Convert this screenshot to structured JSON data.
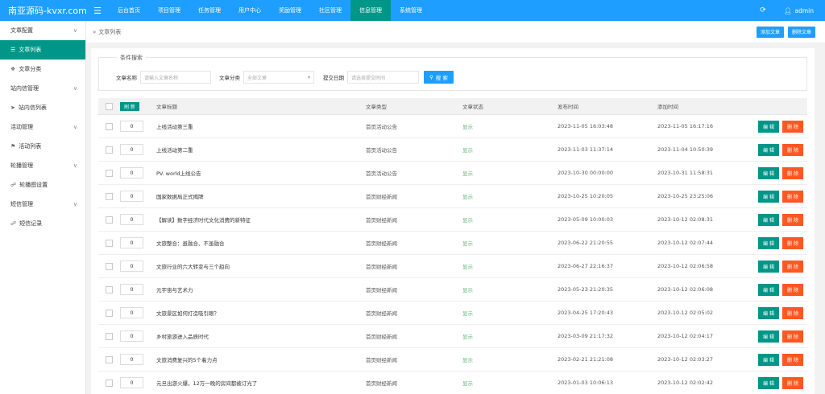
{
  "header": {
    "logo": "南亚源码-kvxr.com",
    "menu_icon": "hamburger-icon",
    "nav": [
      {
        "label": "后台首页",
        "active": false
      },
      {
        "label": "项目管理",
        "active": false
      },
      {
        "label": "任务管理",
        "active": false
      },
      {
        "label": "用户中心",
        "active": false
      },
      {
        "label": "奖励管理",
        "active": false
      },
      {
        "label": "社区管理",
        "active": false
      },
      {
        "label": "信息管理",
        "active": true
      },
      {
        "label": "系统管理",
        "active": false
      }
    ],
    "refresh_icon": "refresh-icon",
    "user_name": "admin"
  },
  "sidebar": {
    "items": [
      {
        "type": "group",
        "label": "文章配置"
      },
      {
        "type": "item",
        "label": "文章列表",
        "active": true
      },
      {
        "type": "item",
        "label": "文章分类",
        "active": false
      },
      {
        "type": "group",
        "label": "站内信管理"
      },
      {
        "type": "item",
        "label": "站内信列表",
        "active": false
      },
      {
        "type": "group",
        "label": "活动管理"
      },
      {
        "type": "item",
        "label": "活动列表",
        "active": false
      },
      {
        "type": "group",
        "label": "轮播管理"
      },
      {
        "type": "item",
        "label": "轮播图设置",
        "active": false
      },
      {
        "type": "group",
        "label": "短信管理"
      },
      {
        "type": "item",
        "label": "短信记录",
        "active": false
      }
    ]
  },
  "breadcrumb": {
    "label": "文章列表"
  },
  "actions": {
    "add": "添加文章",
    "delete": "删除文章"
  },
  "search": {
    "legend": "条件搜索",
    "name_label": "文章名称",
    "name_placeholder": "请输入文章名称",
    "category_label": "文章分类",
    "category_value": "全部文章",
    "date_label": "提交日期",
    "date_placeholder": "请选择提交时间",
    "button": "搜 索"
  },
  "table": {
    "refresh_button": "刷 新",
    "columns": [
      "文章标题",
      "文章类型",
      "文章状态",
      "发布时间",
      "添加时间"
    ],
    "edit_label": "编 辑",
    "delete_label": "删 除",
    "rows": [
      {
        "sort": "0",
        "title": "上线活动第三重",
        "type": "首页活动公告",
        "status": "显示",
        "published": "2023-11-05 16:03:48",
        "added": "2023-11-05 16:17:16"
      },
      {
        "sort": "0",
        "title": "上线活动第二重",
        "type": "首页活动公告",
        "status": "显示",
        "published": "2023-11-03 11:37:14",
        "added": "2023-11-04 10:50:39"
      },
      {
        "sort": "0",
        "title": "PV. world上线公告",
        "type": "首页活动公告",
        "status": "显示",
        "published": "2023-10-30 00:00:00",
        "added": "2023-10-31 11:58:31"
      },
      {
        "sort": "0",
        "title": "国家数据局正式揭牌",
        "type": "首页财经新闻",
        "status": "显示",
        "published": "2023-10-25 10:20:05",
        "added": "2023-10-25 23:25:06"
      },
      {
        "sort": "0",
        "title": "【解读】数字经济时代文化消费的新特征",
        "type": "首页财经新闻",
        "status": "显示",
        "published": "2023-05-09 10:00:03",
        "added": "2023-10-12 02:08:31"
      },
      {
        "sort": "0",
        "title": "文旅整合：虽融合、不虽融合",
        "type": "首页财经新闻",
        "status": "显示",
        "published": "2023-06-22 21:20:55",
        "added": "2023-10-12 02:07:44"
      },
      {
        "sort": "0",
        "title": "文旅行业的六大转变与三个趋向",
        "type": "首页财经新闻",
        "status": "显示",
        "published": "2023-06-27 22:16:37",
        "added": "2023-10-12 02:06:58"
      },
      {
        "sort": "0",
        "title": "元宇宙与艺术力",
        "type": "首页财经新闻",
        "status": "显示",
        "published": "2023-05-23 21:20:35",
        "added": "2023-10-12 02:06:08"
      },
      {
        "sort": "0",
        "title": "文旅景区如何打造吸引眼？",
        "type": "首页财经新闻",
        "status": "显示",
        "published": "2023-04-25 17:20:43",
        "added": "2023-10-12 02:05:02"
      },
      {
        "sort": "0",
        "title": "乡村旅游进入品质时代",
        "type": "首页财经新闻",
        "status": "显示",
        "published": "2023-03-09 21:17:32",
        "added": "2023-10-12 02:04:17"
      },
      {
        "sort": "0",
        "title": "文旅消费复兴的5个着力点",
        "type": "首页财经新闻",
        "status": "显示",
        "published": "2023-02-21 21:21:08",
        "added": "2023-10-12 02:03:27"
      },
      {
        "sort": "0",
        "title": "元旦出游火爆，12万一晚的房间都被订光了",
        "type": "首页财经新闻",
        "status": "显示",
        "published": "2023-01-03 10:06:13",
        "added": "2023-10-12 02:02:42"
      }
    ]
  },
  "colors": {
    "primary": "#1e9fff",
    "accent": "#009688",
    "danger": "#ff5722",
    "status": "#5fb878"
  }
}
